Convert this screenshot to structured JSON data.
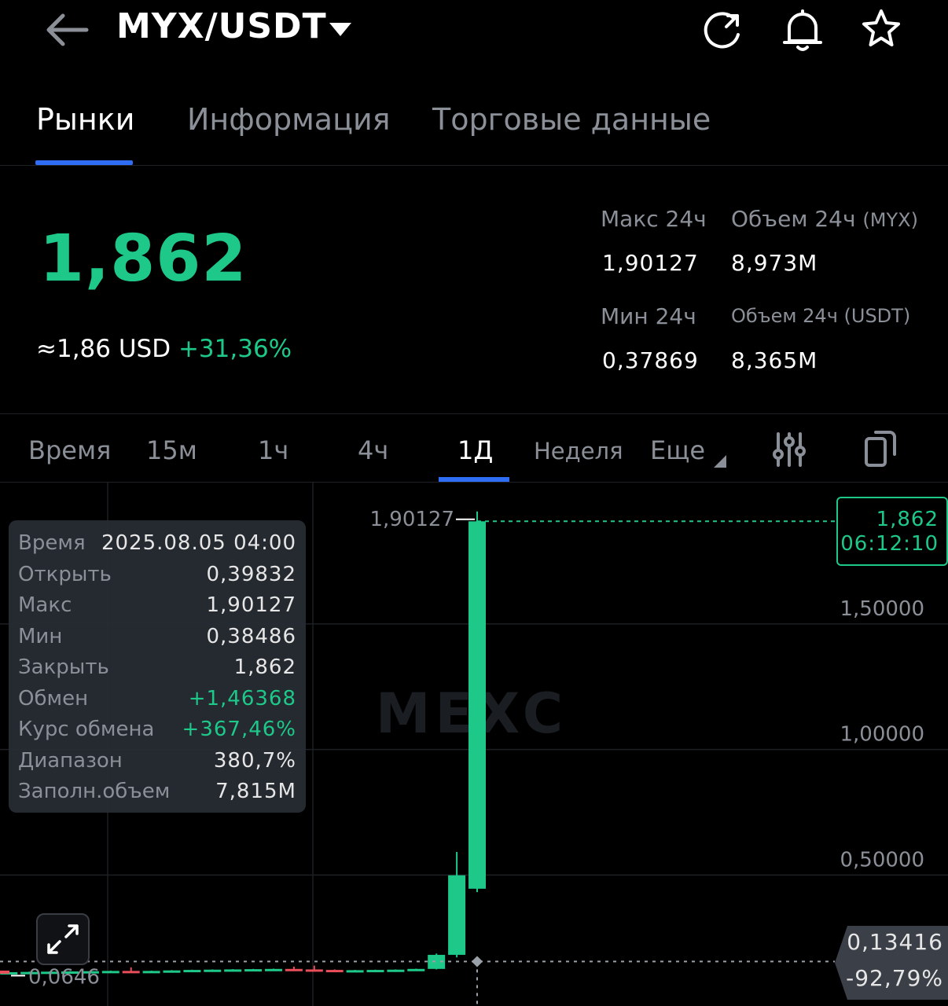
{
  "header": {
    "pair": "MYX/USDT",
    "icons": [
      "back-arrow-icon",
      "dropdown-caret-icon",
      "share-refresh-icon",
      "bell-icon",
      "star-icon"
    ]
  },
  "tabs": [
    {
      "label": "Рынки",
      "active": true
    },
    {
      "label": "Информация",
      "active": false
    },
    {
      "label": "Торговые данные",
      "active": false
    }
  ],
  "price": {
    "last": "1,862",
    "usd": "≈1,86 USD",
    "change": "+31,36%"
  },
  "stats": {
    "high_label": "Макс 24ч",
    "high": "1,90127",
    "vol_base_label": "Объем 24ч",
    "vol_base_unit": "(MYX)",
    "vol_base": "8,973M",
    "low_label": "Мин 24ч",
    "low": "0,37869",
    "vol_quote_label": "Объем 24ч",
    "vol_quote_unit": "(USDT)",
    "vol_quote": "8,365M"
  },
  "timeframes": [
    {
      "label": "Время",
      "active": false
    },
    {
      "label": "15м",
      "active": false
    },
    {
      "label": "1ч",
      "active": false
    },
    {
      "label": "4ч",
      "active": false
    },
    {
      "label": "1Д",
      "active": true
    },
    {
      "label": "Неделя",
      "active": false
    },
    {
      "label": "Еще",
      "active": false
    }
  ],
  "tooltip": {
    "rows": [
      {
        "k": "Время",
        "v": "2025.08.05 04:00",
        "up": false
      },
      {
        "k": "Открыть",
        "v": "0,39832",
        "up": false
      },
      {
        "k": "Макс",
        "v": "1,90127",
        "up": false
      },
      {
        "k": "Мин",
        "v": "0,38486",
        "up": false
      },
      {
        "k": "Закрыть",
        "v": "1,862",
        "up": false
      },
      {
        "k": "Обмен",
        "v": "+1,46368",
        "up": true
      },
      {
        "k": "Курс обмена",
        "v": "+367,46%",
        "up": true
      },
      {
        "k": "Диапазон",
        "v": "380,7%",
        "up": false
      },
      {
        "k": "Заполн.объем",
        "v": "7,815M",
        "up": false
      }
    ]
  },
  "chart_data": {
    "type": "candlestick",
    "watermark": "MEXC",
    "y_ticks": [
      "1,50000",
      "1,00000",
      "0,50000"
    ],
    "y_tick_values": [
      1.5,
      1.0,
      0.5
    ],
    "ylim": [
      -0.05,
      1.96
    ],
    "high_marker": "1,90127",
    "low_marker": "0,0646",
    "current_price": "1,862",
    "countdown": "06:12:10",
    "crosshair_price": "0,13416",
    "crosshair_change": "-92,79%",
    "colors": {
      "up": "#1ec889",
      "down": "#e84e5a"
    },
    "candles": [
      {
        "o": 0.066,
        "h": 0.068,
        "l": 0.064,
        "c": 0.065
      },
      {
        "o": 0.065,
        "h": 0.067,
        "l": 0.064,
        "c": 0.066
      },
      {
        "o": 0.066,
        "h": 0.067,
        "l": 0.065,
        "c": 0.066
      },
      {
        "o": 0.066,
        "h": 0.068,
        "l": 0.065,
        "c": 0.067
      },
      {
        "o": 0.067,
        "h": 0.069,
        "l": 0.066,
        "c": 0.068
      },
      {
        "o": 0.068,
        "h": 0.07,
        "l": 0.067,
        "c": 0.069
      },
      {
        "o": 0.069,
        "h": 0.071,
        "l": 0.068,
        "c": 0.07
      },
      {
        "o": 0.07,
        "h": 0.072,
        "l": 0.069,
        "c": 0.071
      },
      {
        "o": 0.071,
        "h": 0.085,
        "l": 0.066,
        "c": 0.068
      },
      {
        "o": 0.068,
        "h": 0.072,
        "l": 0.067,
        "c": 0.071
      },
      {
        "o": 0.071,
        "h": 0.074,
        "l": 0.07,
        "c": 0.073
      },
      {
        "o": 0.073,
        "h": 0.076,
        "l": 0.072,
        "c": 0.075
      },
      {
        "o": 0.075,
        "h": 0.077,
        "l": 0.074,
        "c": 0.076
      },
      {
        "o": 0.076,
        "h": 0.078,
        "l": 0.075,
        "c": 0.077
      },
      {
        "o": 0.077,
        "h": 0.079,
        "l": 0.076,
        "c": 0.078
      },
      {
        "o": 0.078,
        "h": 0.08,
        "l": 0.077,
        "c": 0.079
      },
      {
        "o": 0.079,
        "h": 0.088,
        "l": 0.075,
        "c": 0.077
      },
      {
        "o": 0.077,
        "h": 0.092,
        "l": 0.073,
        "c": 0.075
      },
      {
        "o": 0.075,
        "h": 0.077,
        "l": 0.072,
        "c": 0.073
      },
      {
        "o": 0.073,
        "h": 0.075,
        "l": 0.072,
        "c": 0.074
      },
      {
        "o": 0.074,
        "h": 0.076,
        "l": 0.073,
        "c": 0.075
      },
      {
        "o": 0.075,
        "h": 0.077,
        "l": 0.074,
        "c": 0.076
      },
      {
        "o": 0.076,
        "h": 0.08,
        "l": 0.075,
        "c": 0.079
      },
      {
        "o": 0.079,
        "h": 0.14,
        "l": 0.077,
        "c": 0.135
      },
      {
        "o": 0.135,
        "h": 0.545,
        "l": 0.125,
        "c": 0.452
      },
      {
        "o": 0.39832,
        "h": 1.90127,
        "l": 0.38486,
        "c": 1.862
      }
    ]
  }
}
